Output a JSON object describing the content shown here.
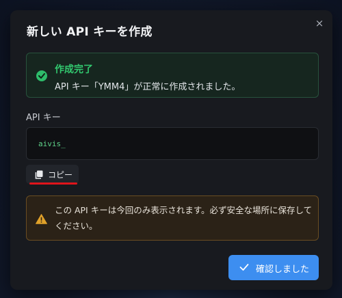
{
  "dialog": {
    "title": "新しい API キーを作成",
    "close_label": "×"
  },
  "success": {
    "heading": "作成完了",
    "message": "API キー「YMM4」が正常に作成されました。",
    "color": "#32c96f"
  },
  "api_key": {
    "label": "API キー",
    "value": "aivis_",
    "copy_label": "コピー"
  },
  "warning": {
    "message": "この API キーは今回のみ表示されます。必ず安全な場所に保存してください。",
    "color": "#e0a12a"
  },
  "footer": {
    "confirm_label": "確認しました",
    "accent": "#3d8ef0"
  },
  "annotation": {
    "color": "#e0141b"
  }
}
